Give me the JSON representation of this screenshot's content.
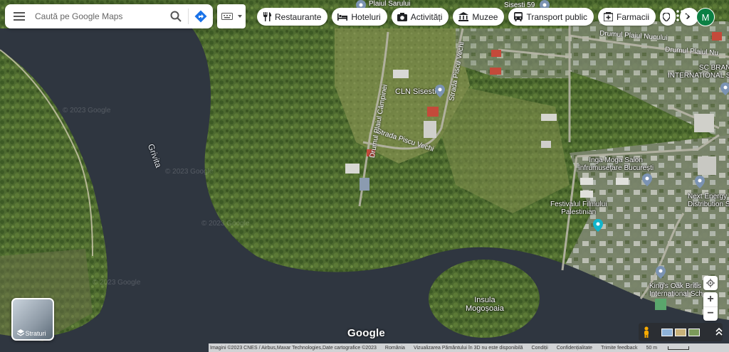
{
  "search": {
    "placeholder": "Caută pe Google Maps"
  },
  "chips": [
    {
      "label": "Restaurante",
      "icon": "fork-knife-icon"
    },
    {
      "label": "Hoteluri",
      "icon": "bed-icon"
    },
    {
      "label": "Activități",
      "icon": "camera-icon"
    },
    {
      "label": "Muzee",
      "icon": "museum-icon"
    },
    {
      "label": "Transport public",
      "icon": "bus-icon"
    },
    {
      "label": "Farmacii",
      "icon": "pharmacy-icon"
    }
  ],
  "account": {
    "initial": "M",
    "color": "#0b8043"
  },
  "map_labels": {
    "grivita": "Grivita",
    "insula": "Insula\nMogoșoaia",
    "cln": "CLN Sisesti",
    "inga": "Inga Moga Salon\nînfrumusețare București",
    "festival": "Festivalul Filmului\nPalestinian",
    "kings": "King's Oak Britis\nInternational Sch",
    "nextenergy": "Next Energy\nDistribution S",
    "scbrand": "SC BRAN\nINTERNATIONAL S",
    "plaiul_sarului": "Plaiul Sarului",
    "sisesti59": "Sisesti 59",
    "drumul_plaiu_nucului": "Drumul Plaiul Nucului",
    "drumul_plaiul_nucului2": "Drumul Plaiul Nu",
    "strada_piscu_vechi": "Strada Piscu Vechi",
    "strada_piscu_vechi2": "Strada Piscu Vechi",
    "drumul_plaiul_campinei": "Drumul Plaiul Câmpinei",
    "watermark1": "© 2023 Google",
    "watermark2": "© 2023 Google",
    "watermark3": "© 2023 Google",
    "watermark4": "© 2023 Google"
  },
  "layers": {
    "label": "Straturi"
  },
  "google_logo": "Google",
  "footer": {
    "imagery": "Imagini ©2023 CNES / Airbus,Maxar Technologies,Date cartografice ©2023",
    "country": "România",
    "note": "Vizualizarea Pământului în 3D nu este disponibilă",
    "terms": "Condiții",
    "privacy": "Confidențialitate",
    "feedback": "Trimite feedback",
    "scale": "50 m"
  }
}
